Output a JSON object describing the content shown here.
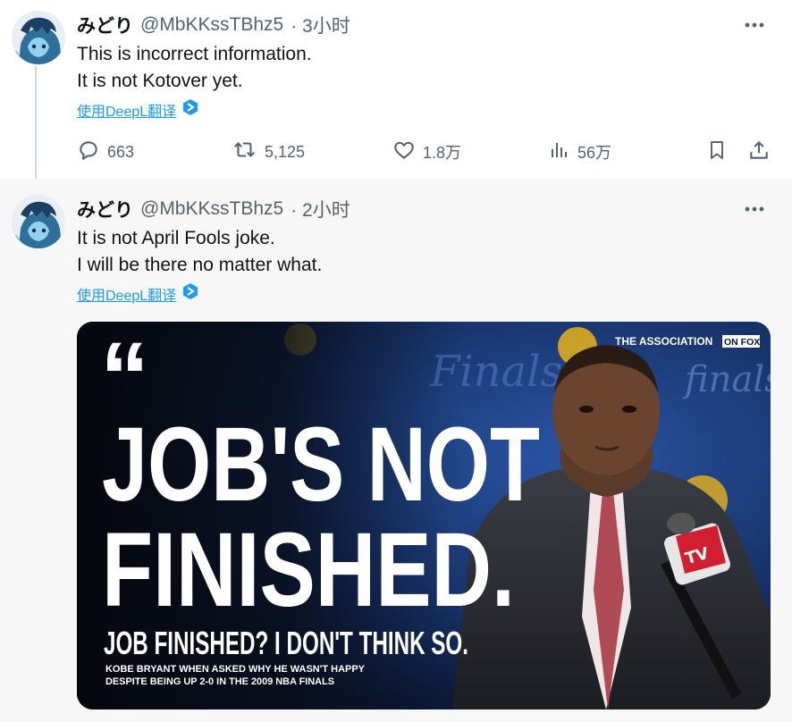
{
  "tweets": [
    {
      "name": "みどり",
      "handle": "@MbKKssTBhz5",
      "time": "· 3小时",
      "lines": [
        "This is incorrect information.",
        "It is not Kotover yet."
      ],
      "translate": "使用DeepL翻译",
      "actions": {
        "reply": "663",
        "retweet": "5,125",
        "like": "1.8万",
        "views": "56万"
      }
    },
    {
      "name": "みどり",
      "handle": "@MbKKssTBhz5",
      "time": "· 2小时",
      "lines": [
        "It is not April Fools joke.",
        "I will be there no matter what."
      ],
      "translate": "使用DeepL翻译",
      "media": {
        "brand_label": "THE ASSOCIATION",
        "brand_tag": "ON FOX",
        "quote_mark": "“",
        "headline_1": "JOB'S NOT",
        "headline_2": "FINISHED.",
        "sub": "JOB FINISHED? I DON'T THINK SO.",
        "caption_1": "KOBE BRYANT WHEN ASKED WHY HE WASN'T HAPPY",
        "caption_2": "DESPITE BEING UP 2-0 IN THE 2009 NBA FINALS",
        "bg_finals_1": "Finals",
        "bg_finals_2": "finals",
        "mic_label": "TV"
      }
    }
  ],
  "colors": {
    "link": "#1d9bf0",
    "muted": "#536471",
    "thread": "#cfd9de"
  },
  "icons": [
    "more-icon",
    "deepl-icon",
    "reply-icon",
    "retweet-icon",
    "like-icon",
    "views-icon",
    "bookmark-icon",
    "share-icon"
  ]
}
